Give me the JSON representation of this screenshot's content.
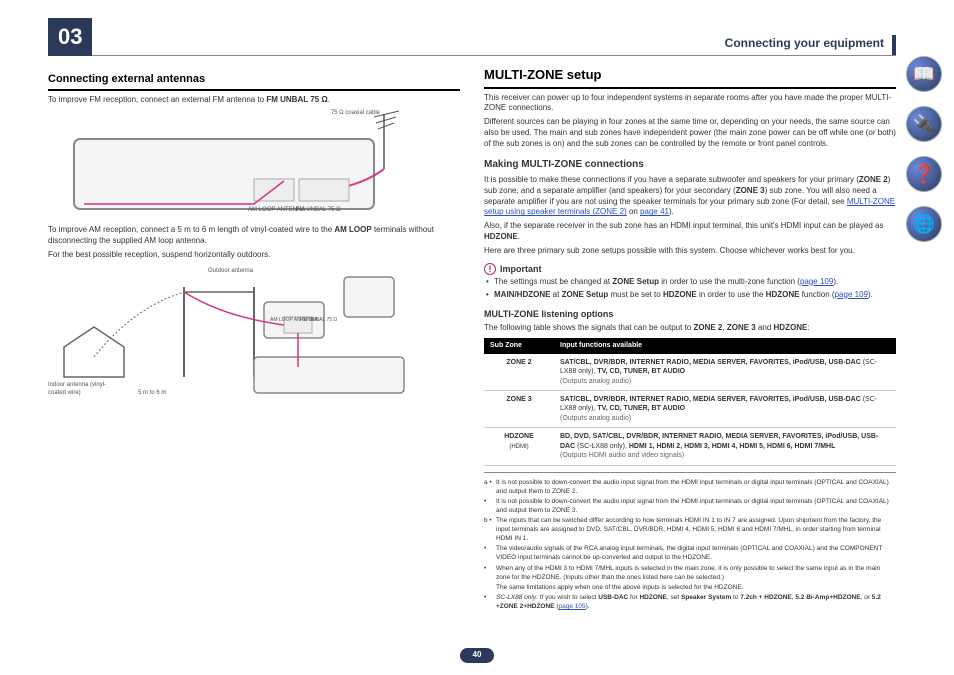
{
  "chapter": "03",
  "header_title": "Connecting your equipment",
  "page_number": "40",
  "left": {
    "h_antennas": "Connecting external antennas",
    "p1_a": "To improve FM reception, connect an external FM antenna to ",
    "p1_b": "FM UNBAL 75 Ω",
    "p1_c": ".",
    "diag1_label": "75 Ω coaxial cable",
    "diag1_port1": "AM LOOP ANTENNA",
    "diag1_port2": "FM UNBAL 75 Ω",
    "p2_a": "To improve AM reception, connect a 5 m to 6 m length of vinyl-coated wire to the ",
    "p2_b": "AM LOOP",
    "p2_c": " terminals without disconnecting the supplied AM loop antenna.",
    "p3": "For the best possible reception, suspend horizontally outdoors.",
    "diag2_outdoor": "Outdoor antenna",
    "diag2_indoor": "Indoor antenna (vinyl-coated wire)",
    "diag2_len": "5 m to 6 m",
    "diag2_port1": "AM LOOP ANTENNA",
    "diag2_port2": "FM UNBAL 75 Ω"
  },
  "right": {
    "h_multizone": "MULTI-ZONE setup",
    "mz_p1": "This receiver can power up to four independent systems in separate rooms after you have made the proper MULTI-ZONE connections.",
    "mz_p2": "Different sources can be playing in four zones at the same time or, depending on your needs, the same source can also be used. The main and sub zones have independent power (the main zone power can be off while one (or both) of the sub zones is on) and the sub zones can be controlled by the remote or front panel controls.",
    "h_making": "Making MULTI-ZONE connections",
    "mk_p1_a": "It is possible to make these connections if you have a separate subwoofer and speakers for your primary (",
    "mk_p1_b": "ZONE 2",
    "mk_p1_c": ") sub zone, and a separate amplifier (and speakers) for your secondary (",
    "mk_p1_d": "ZONE 3",
    "mk_p1_e": ") sub zone. You will also need a separate amplifier if you are not using the speaker terminals for your primary sub zone (For detail, see ",
    "mk_link": "MULTI-ZONE setup using speaker terminals (ZONE 2)",
    "mk_p1_f": " on ",
    "mk_link_page": "page 41",
    "mk_p1_g": ").",
    "mk_p2_a": "Also, if the separate receiver in the sub zone has an HDMI input terminal, this unit's HDMI input can be played as ",
    "mk_p2_b": "HDZONE",
    "mk_p2_c": ".",
    "mk_p3": "Here are three primary sub zone setups possible with this system. Choose whichever works best for you.",
    "important_label": "Important",
    "imp_b1_a": "The settings must be changed at ",
    "imp_b1_b": "ZONE Setup",
    "imp_b1_c": " in order to use the multi-zone function (",
    "imp_b1_link": "page 109",
    "imp_b1_d": ").",
    "imp_b2_a": "MAIN/HDZONE",
    "imp_b2_b": " at ",
    "imp_b2_c": "ZONE Setup",
    "imp_b2_d": " must be set to ",
    "imp_b2_e": "HDZONE",
    "imp_b2_f": " in order to use the ",
    "imp_b2_g": "HDZONE",
    "imp_b2_h": " function (",
    "imp_b2_link": "page 109",
    "imp_b2_i": ").",
    "h_listening": "MULTI-ZONE listening options",
    "lo_intro_a": "The following table shows the signals that can be output to ",
    "lo_intro_b": "ZONE 2",
    "lo_intro_c": ", ",
    "lo_intro_d": "ZONE 3",
    "lo_intro_e": " and ",
    "lo_intro_f": "HDZONE",
    "lo_intro_g": ":",
    "table": {
      "th1": "Sub Zone",
      "th2": "Input functions available",
      "rows": [
        {
          "zone": "ZONE 2",
          "zone_sub": "<a>",
          "funcs_b": "SAT/CBL, DVR/BDR, INTERNET RADIO, MEDIA SERVER, FAVORITES, iPod/USB, USB-DAC",
          "funcs_paren": " (SC-LX88 only), ",
          "funcs_b2": "TV, CD, TUNER, BT AUDIO",
          "out": "(Outputs analog audio)"
        },
        {
          "zone": "ZONE 3",
          "zone_sub": "<a>",
          "funcs_b": "SAT/CBL, DVR/BDR, INTERNET RADIO, MEDIA SERVER, FAVORITES, iPod/USB, USB-DAC",
          "funcs_paren": " (SC-LX88 only), ",
          "funcs_b2": "TV, CD, TUNER, BT AUDIO",
          "out": "(Outputs analog audio)"
        },
        {
          "zone": "HDZONE",
          "zone_sub": "(HDMI)\n<b>",
          "funcs_b": "BD, DVD, SAT/CBL, DVR/BDR, INTERNET RADIO, MEDIA SERVER, FAVORITES, iPod/USB, USB-DAC",
          "funcs_paren": " (SC-LX88 only), ",
          "funcs_b2": "HDMI 1, HDMI 2, HDMI 3, HDMI 4, HDMI 5, HDMI 6, HDMI 7/MHL",
          "out": "(Outputs HDMI audio and video signals)"
        }
      ]
    },
    "footnotes": {
      "a1": "It is not possible to down-convert the audio input signal from the HDMI input terminals or digital input terminals (OPTICAL and COAXIAL) and output them to ZONE 2.",
      "a2": "It is not possible to down-convert the audio input signal from the HDMI input terminals or digital input terminals (OPTICAL and COAXIAL) and output them to ZONE 3.",
      "b1": "The inputs that can be switched differ according to how terminals HDMI IN 1 to IN 7 are assigned. Upon shipment from the factory, the input terminals are assigned to DVD, SAT/CBL, DVR/BDR, HDMI 4, HDMI 5, HDMI 6 and HDMI 7/MHL, in order starting from terminal HDMI IN 1.",
      "b2": "The video/audio signals of the RCA analog input terminals, the digital input terminals (OPTICAL and COAXIAL) and the COMPONENT VIDEO input terminals cannot be up-converted and output to the HDZONE.",
      "b3": "When any of the HDMI 3 to HDMI 7/MHL inputs is selected in the main zone, it is only possible to select the same input as in the main zone for the HDZONE. (Inputs other than the ones listed here can be selected.)",
      "b3b": "The same limitations apply when one of the above inputs is selected for the HDZONE.",
      "b4_a": "SC-LX88 only:",
      "b4_b": " If you wish to select ",
      "b4_c": "USB-DAC",
      "b4_d": " for ",
      "b4_e": "HDZONE",
      "b4_f": ", set ",
      "b4_g": "Speaker System",
      "b4_h": " to ",
      "b4_i": "7.2ch + HDZONE",
      "b4_j": ", ",
      "b4_k": "5.2 Bi-Amp+HDZONE",
      "b4_l": ", or ",
      "b4_m": "5.2 +ZONE 2+HDZONE",
      "b4_n": " (",
      "b4_link": "page 105",
      "b4_o": ")."
    }
  },
  "side_icons": [
    "book-icon",
    "receiver-icon",
    "help-icon",
    "network-icon"
  ]
}
